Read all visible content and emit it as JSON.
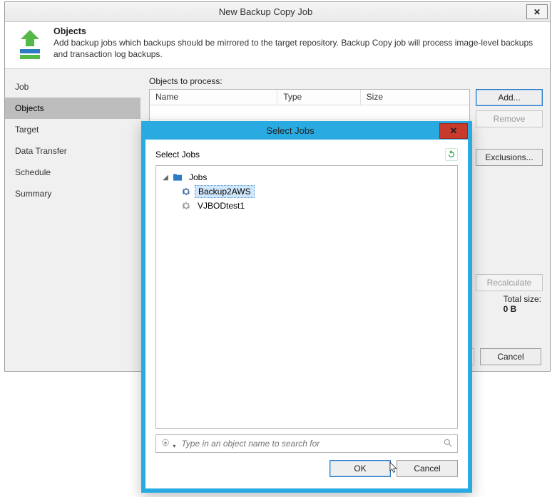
{
  "window": {
    "title": "New Backup Copy Job"
  },
  "banner": {
    "heading": "Objects",
    "desc": "Add backup jobs which backups should be mirrored to the target repository. Backup Copy job will process image-level backups and transaction log backups."
  },
  "nav": {
    "items": [
      "Job",
      "Objects",
      "Target",
      "Data Transfer",
      "Schedule",
      "Summary"
    ],
    "active_index": 1
  },
  "content": {
    "list_label": "Objects to process:",
    "columns": [
      "Name",
      "Type",
      "Size"
    ],
    "rows": [],
    "buttons": {
      "add": "Add...",
      "remove": "Remove",
      "exclusions": "Exclusions...",
      "recalculate": "Recalculate"
    },
    "totals": {
      "label": "Total size:",
      "value": "0 B"
    },
    "footer_cancel": "Cancel"
  },
  "modal": {
    "title": "Select Jobs",
    "header_label": "Select Jobs",
    "root_label": "Jobs",
    "items": [
      {
        "label": "Backup2AWS",
        "selected": true
      },
      {
        "label": "VJBODtest1",
        "selected": false
      }
    ],
    "search_placeholder": "Type in an object name to search for",
    "ok": "OK",
    "cancel": "Cancel"
  }
}
